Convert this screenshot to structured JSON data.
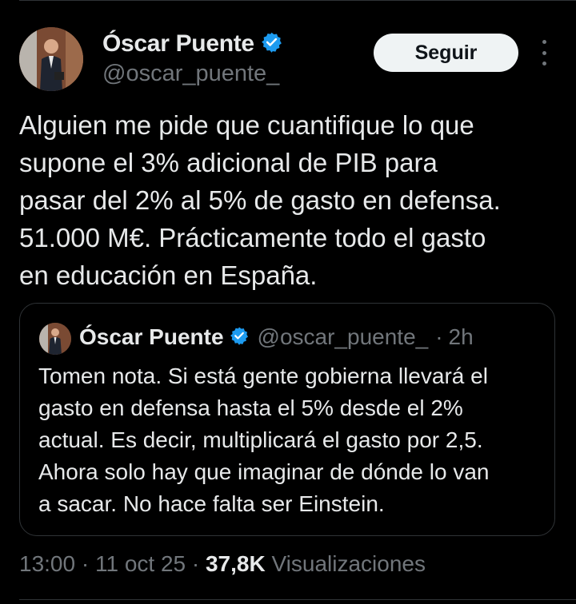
{
  "author": {
    "name": "Óscar Puente",
    "handle": "@oscar_puente_",
    "verified_color": "#1d9bf0"
  },
  "follow_button": {
    "label": "Seguir"
  },
  "tweet": {
    "lines": [
      "Alguien me pide que cuantifique lo que",
      "supone el 3% adicional de PIB para",
      "pasar del 2% al 5% de gasto en defensa.",
      "51.000 M€. Prácticamente todo el gasto",
      "en educación en España."
    ]
  },
  "quoted_tweet": {
    "name": "Óscar Puente",
    "handle": "@oscar_puente_",
    "separator": "·",
    "time": "2h",
    "lines": [
      "Tomen nota. Si está gente gobierna llevará el",
      "gasto en defensa hasta el 5% desde el 2%",
      "actual. Es decir, multiplicará el gasto por 2,5.",
      "Ahora solo hay que imaginar de dónde lo van",
      "a sacar. No hace falta ser Einstein."
    ]
  },
  "meta": {
    "time": "13:00",
    "date": "11 oct 25",
    "views_count": "37,8K",
    "views_label": "Visualizaciones"
  }
}
